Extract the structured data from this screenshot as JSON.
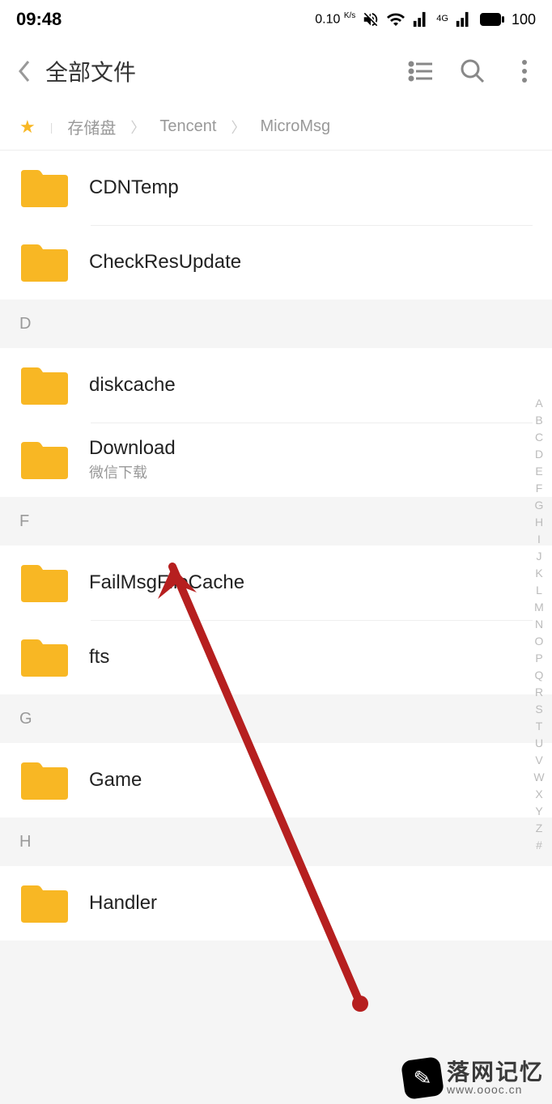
{
  "statusBar": {
    "time": "09:48",
    "netSpeed": "0.10",
    "netUnit": "K/s",
    "battery": "100"
  },
  "header": {
    "title": "全部文件"
  },
  "breadcrumb": {
    "items": [
      "存储盘",
      "Tencent",
      "MicroMsg"
    ]
  },
  "sections": [
    {
      "letter": "",
      "folders": [
        {
          "name": "CDNTemp",
          "sub": ""
        },
        {
          "name": "CheckResUpdate",
          "sub": ""
        }
      ]
    },
    {
      "letter": "D",
      "folders": [
        {
          "name": "diskcache",
          "sub": ""
        },
        {
          "name": "Download",
          "sub": "微信下载"
        }
      ]
    },
    {
      "letter": "F",
      "folders": [
        {
          "name": "FailMsgFileCache",
          "sub": ""
        },
        {
          "name": "fts",
          "sub": ""
        }
      ]
    },
    {
      "letter": "G",
      "folders": [
        {
          "name": "Game",
          "sub": ""
        }
      ]
    },
    {
      "letter": "H",
      "folders": [
        {
          "name": "Handler",
          "sub": ""
        }
      ]
    }
  ],
  "azIndex": [
    "A",
    "B",
    "C",
    "D",
    "E",
    "F",
    "G",
    "H",
    "I",
    "J",
    "K",
    "L",
    "M",
    "N",
    "O",
    "P",
    "Q",
    "R",
    "S",
    "T",
    "U",
    "V",
    "W",
    "X",
    "Y",
    "Z",
    "#"
  ],
  "watermark": {
    "main": "落网记忆",
    "sub": "www.oooc.cn"
  }
}
